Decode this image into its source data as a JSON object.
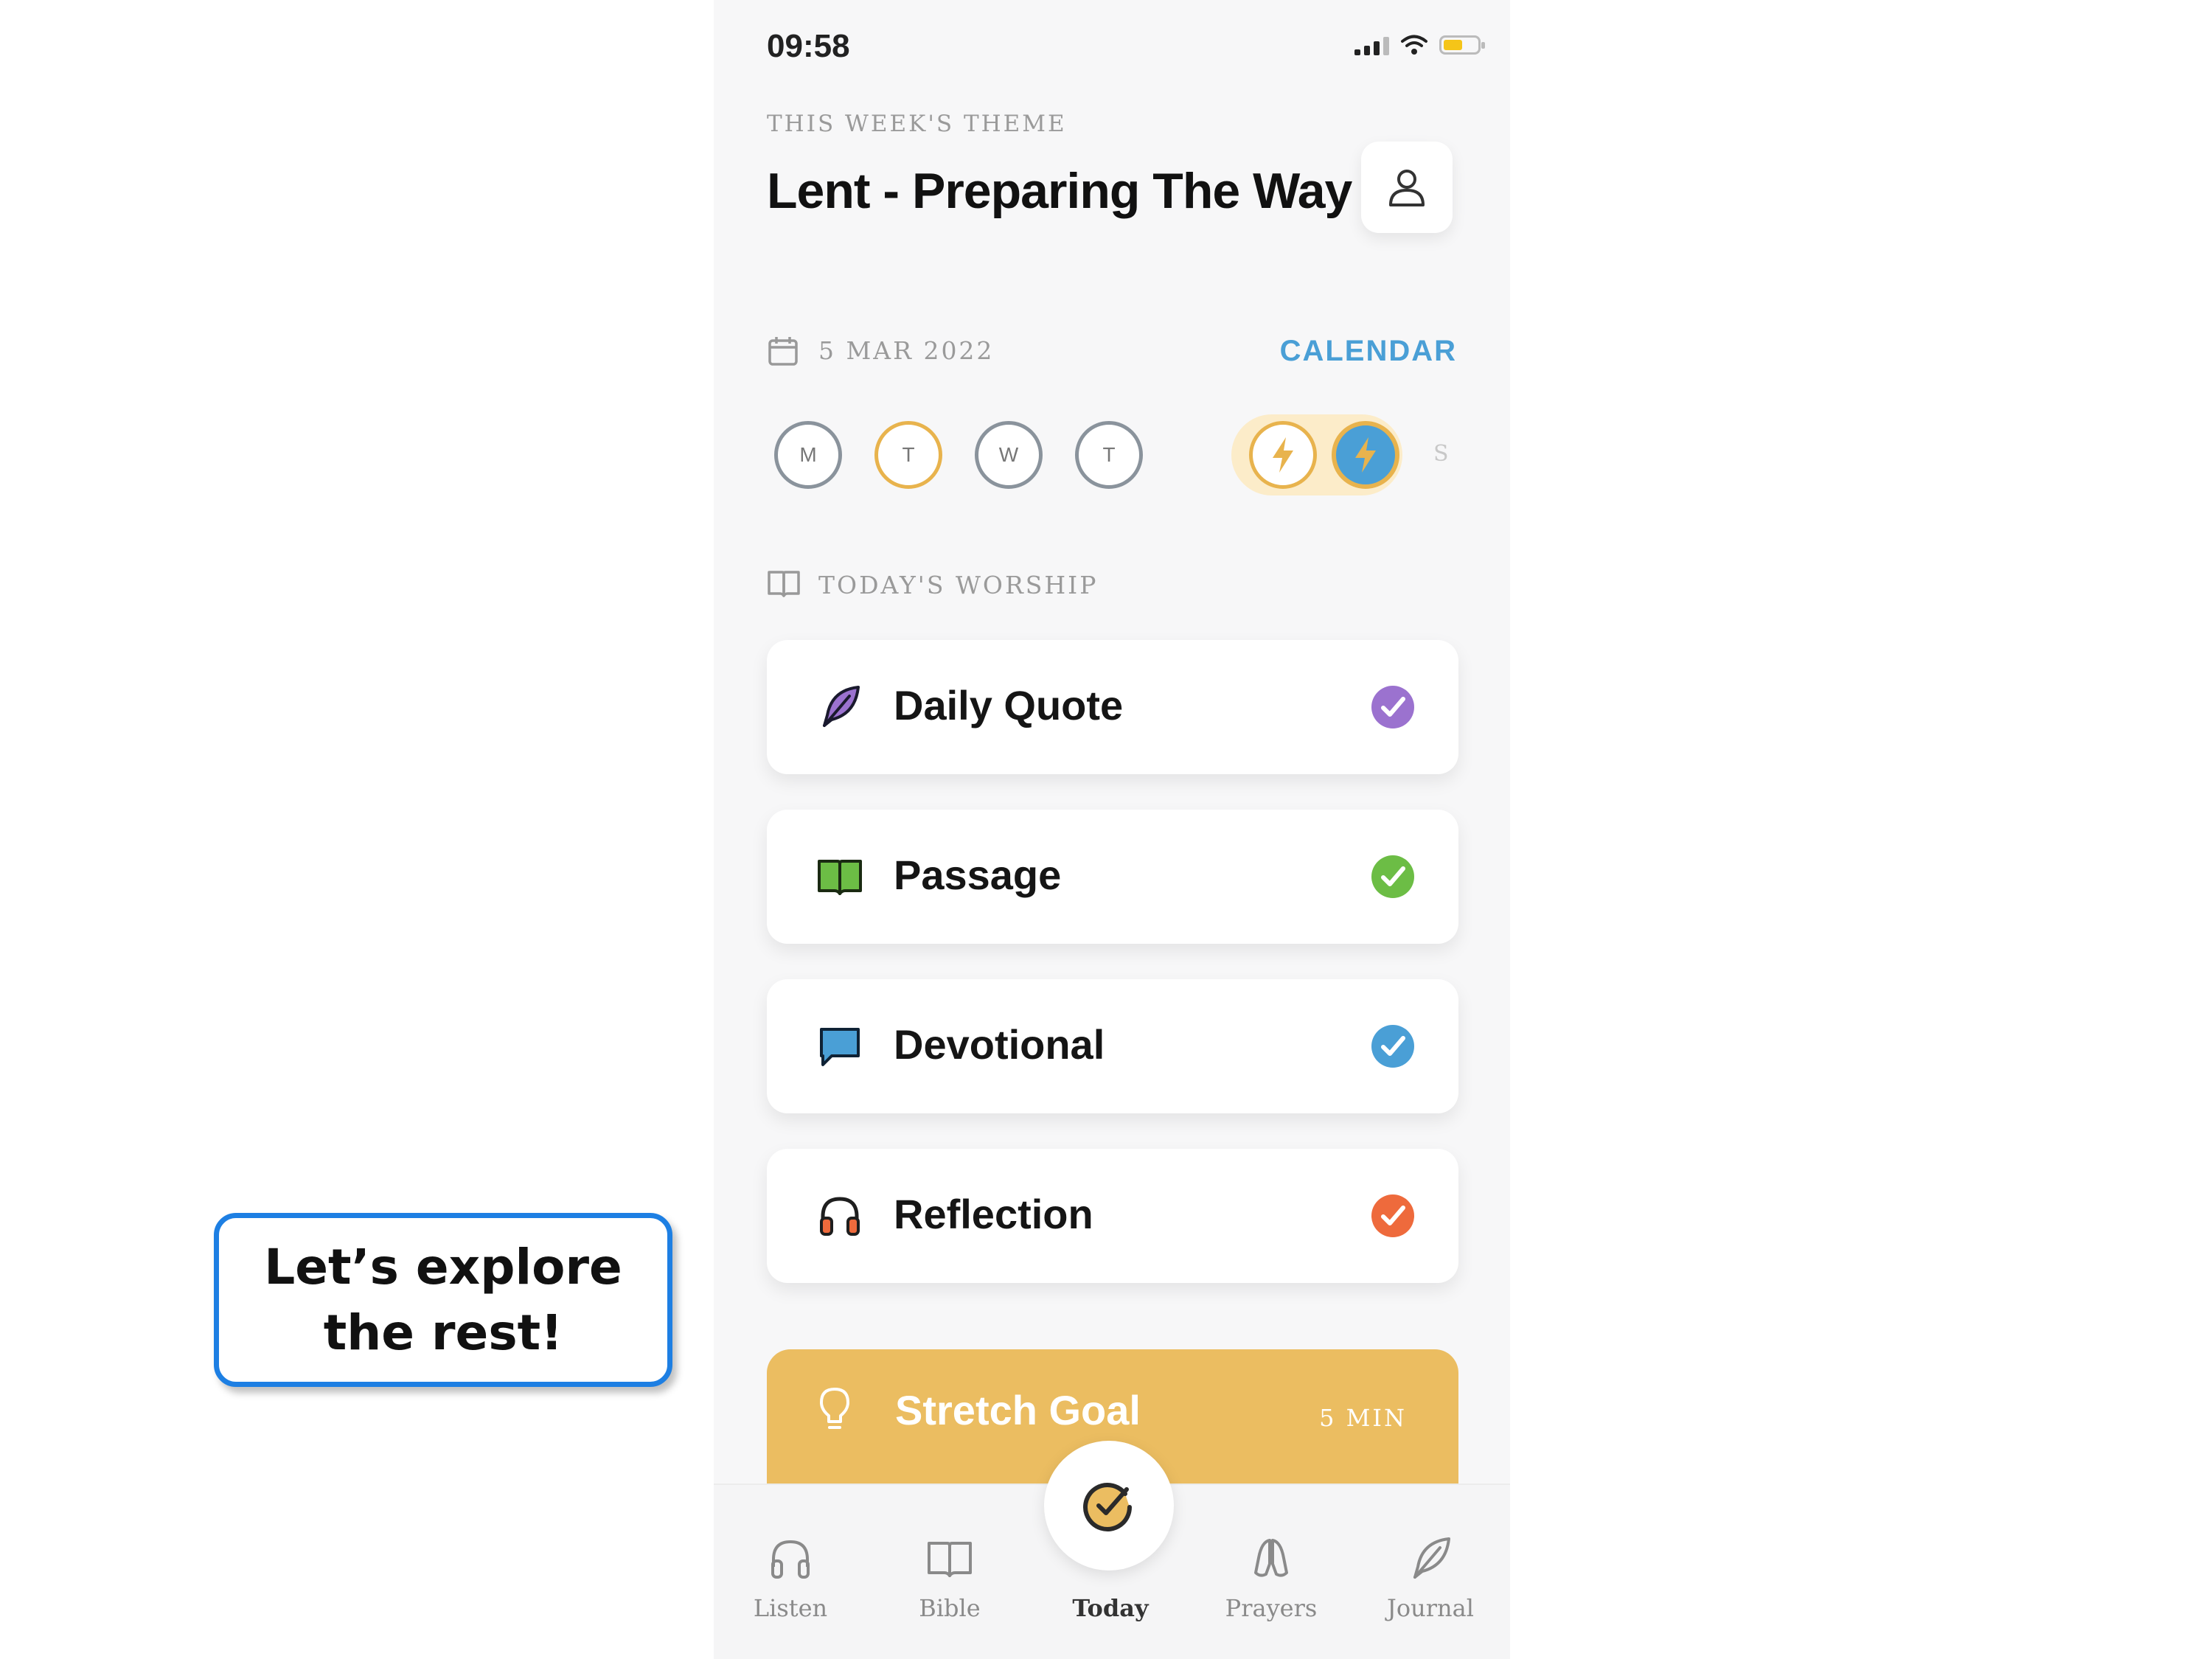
{
  "status_bar": {
    "time": "09:58"
  },
  "header": {
    "eyebrow": "THIS WEEK'S THEME",
    "title": "Lent - Preparing The Way"
  },
  "date_row": {
    "date": "5 MAR 2022",
    "calendar_link": "CALENDAR"
  },
  "week_days": [
    {
      "label": "M",
      "state": "gray"
    },
    {
      "label": "T",
      "state": "gold"
    },
    {
      "label": "W",
      "state": "gray"
    },
    {
      "label": "T",
      "state": "gray"
    },
    {
      "label": "",
      "state": "streak",
      "icon": "lightning-icon"
    },
    {
      "label": "",
      "state": "today",
      "icon": "lightning-icon"
    },
    {
      "label": "S",
      "state": "upcoming"
    }
  ],
  "worship": {
    "label": "TODAY'S WORSHIP",
    "items": [
      {
        "title": "Daily Quote",
        "icon": "feather-icon",
        "check_color": "#9b72cf"
      },
      {
        "title": "Passage",
        "icon": "open-book-icon",
        "check_color": "#6cbd45"
      },
      {
        "title": "Devotional",
        "icon": "speech-bubble-icon",
        "check_color": "#4a9fd6"
      },
      {
        "title": "Reflection",
        "icon": "headphones-icon",
        "check_color": "#ee6a3c"
      }
    ]
  },
  "stretch_goal": {
    "title": "Stretch Goal",
    "duration": "5 MIN",
    "icon": "lightbulb-icon"
  },
  "tab_bar": {
    "tabs": [
      {
        "label": "Listen",
        "icon": "headphones-icon"
      },
      {
        "label": "Bible",
        "icon": "book-icon"
      },
      {
        "label": "Today",
        "icon": "check-circle-icon",
        "active": true
      },
      {
        "label": "Prayers",
        "icon": "praying-hands-icon"
      },
      {
        "label": "Journal",
        "icon": "feather-icon"
      }
    ]
  },
  "callout": {
    "text": "Let’s explore the rest!"
  },
  "colors": {
    "accent_blue": "#4a9fd6",
    "gold": "#e8b34d",
    "stretch_bg": "#ebbd61"
  }
}
